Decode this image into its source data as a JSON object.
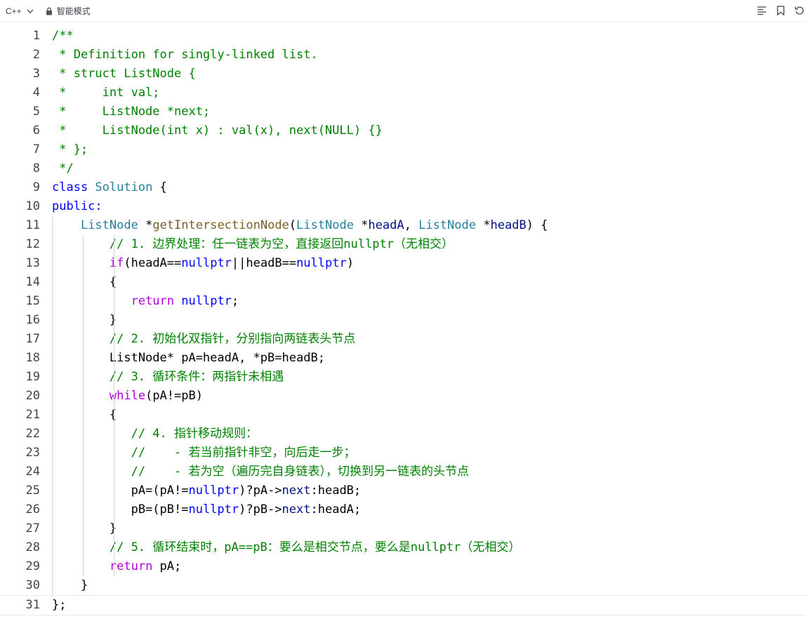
{
  "toolbar": {
    "language": "C++",
    "mode_label": "智能模式",
    "icons": [
      "format-icon",
      "bookmark-icon",
      "reset-icon"
    ]
  },
  "editor": {
    "lines": [
      [
        [
          "c-com",
          "/**"
        ]
      ],
      [
        [
          "c-com",
          " * Definition for singly-linked list."
        ]
      ],
      [
        [
          "c-com",
          " * struct ListNode {"
        ]
      ],
      [
        [
          "c-com",
          " *     int val;"
        ]
      ],
      [
        [
          "c-com",
          " *     ListNode *next;"
        ]
      ],
      [
        [
          "c-com",
          " *     ListNode(int x) : val(x), next(NULL) {}"
        ]
      ],
      [
        [
          "c-com",
          " * };"
        ]
      ],
      [
        [
          "c-com",
          " */"
        ]
      ],
      [
        [
          "c-kw",
          "class "
        ],
        [
          "c-type",
          "Solution"
        ],
        [
          "c-plain",
          " {"
        ]
      ],
      [
        [
          "c-kw",
          "public:"
        ]
      ],
      [
        [
          "c-plain",
          "    "
        ],
        [
          "c-type",
          "ListNode"
        ],
        [
          "c-plain",
          " *"
        ],
        [
          "c-fn",
          "getIntersectionNode"
        ],
        [
          "c-plain",
          "("
        ],
        [
          "c-type",
          "ListNode"
        ],
        [
          "c-plain",
          " *"
        ],
        [
          "c-var",
          "headA"
        ],
        [
          "c-plain",
          ", "
        ],
        [
          "c-type",
          "ListNode"
        ],
        [
          "c-plain",
          " *"
        ],
        [
          "c-var",
          "headB"
        ],
        [
          "c-plain",
          ") {"
        ]
      ],
      [
        [
          "c-plain",
          "        "
        ],
        [
          "c-com",
          "// 1. 边界处理：任一链表为空，直接返回nullptr（无相交）"
        ]
      ],
      [
        [
          "c-plain",
          "        "
        ],
        [
          "c-ctl",
          "if"
        ],
        [
          "c-plain",
          "(headA=="
        ],
        [
          "c-kw",
          "nullptr"
        ],
        [
          "c-plain",
          "||headB=="
        ],
        [
          "c-kw",
          "nullptr"
        ],
        [
          "c-plain",
          ")"
        ]
      ],
      [
        [
          "c-plain",
          "        {"
        ]
      ],
      [
        [
          "c-plain",
          "           "
        ],
        [
          "c-ctl",
          "return"
        ],
        [
          "c-plain",
          " "
        ],
        [
          "c-kw",
          "nullptr"
        ],
        [
          "c-plain",
          ";"
        ]
      ],
      [
        [
          "c-plain",
          "        }"
        ]
      ],
      [
        [
          "c-plain",
          "        "
        ],
        [
          "c-com",
          "// 2. 初始化双指针，分别指向两链表头节点"
        ]
      ],
      [
        [
          "c-plain",
          "        ListNode* pA=headA, *pB=headB;"
        ]
      ],
      [
        [
          "c-plain",
          "        "
        ],
        [
          "c-com",
          "// 3. 循环条件：两指针未相遇"
        ]
      ],
      [
        [
          "c-plain",
          "        "
        ],
        [
          "c-ctl",
          "while"
        ],
        [
          "c-plain",
          "(pA!=pB)"
        ]
      ],
      [
        [
          "c-plain",
          "        {"
        ]
      ],
      [
        [
          "c-plain",
          "           "
        ],
        [
          "c-com",
          "// 4. 指针移动规则："
        ]
      ],
      [
        [
          "c-plain",
          "           "
        ],
        [
          "c-com",
          "//    - 若当前指针非空，向后走一步；"
        ]
      ],
      [
        [
          "c-plain",
          "           "
        ],
        [
          "c-com",
          "//    - 若为空（遍历完自身链表），切换到另一链表的头节点"
        ]
      ],
      [
        [
          "c-plain",
          "           pA=(pA!="
        ],
        [
          "c-kw",
          "nullptr"
        ],
        [
          "c-plain",
          ")?pA->"
        ],
        [
          "c-var",
          "next"
        ],
        [
          "c-plain",
          ":headB;"
        ]
      ],
      [
        [
          "c-plain",
          "           pB=(pB!="
        ],
        [
          "c-kw",
          "nullptr"
        ],
        [
          "c-plain",
          ")?pB->"
        ],
        [
          "c-var",
          "next"
        ],
        [
          "c-plain",
          ":headA;"
        ]
      ],
      [
        [
          "c-plain",
          "        }"
        ]
      ],
      [
        [
          "c-plain",
          "        "
        ],
        [
          "c-com",
          "// 5. 循环结束时，pA==pB：要么是相交节点，要么是nullptr（无相交）"
        ]
      ],
      [
        [
          "c-plain",
          "        "
        ],
        [
          "c-ctl",
          "return"
        ],
        [
          "c-plain",
          " pA;"
        ]
      ],
      [
        [
          "c-plain",
          "    }"
        ]
      ],
      [
        [
          "c-plain",
          "};"
        ]
      ]
    ]
  }
}
